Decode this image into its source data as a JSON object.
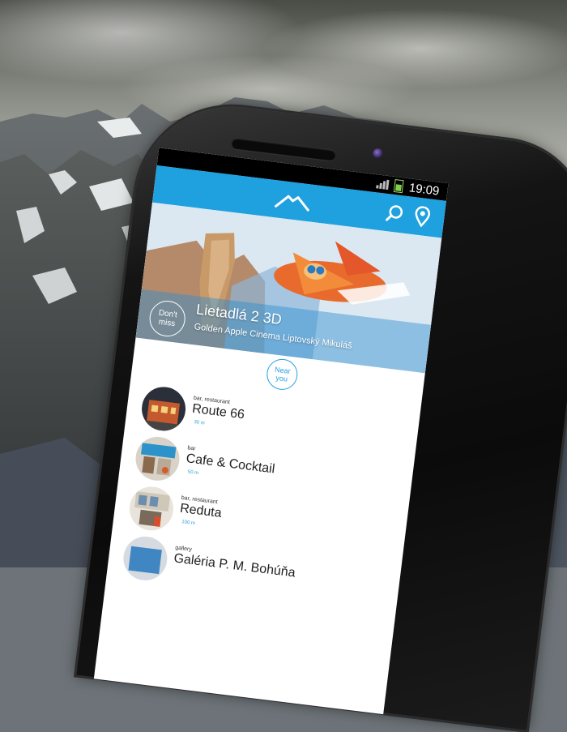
{
  "status": {
    "time": "19:09"
  },
  "appbar": {
    "logo_icon": "mountain-logo-icon",
    "actions": [
      "search-icon",
      "location-pin-icon"
    ],
    "accent": "#1fa0df"
  },
  "featured": {
    "badge": "Don't miss",
    "badge_line1": "Don't",
    "badge_line2": "miss",
    "title": "Lietadlá 2 3D",
    "venue": "Golden Apple Cinema Liptovský Mikuláš"
  },
  "near_button": {
    "line1": "Near",
    "line2": "you"
  },
  "places": [
    {
      "category": "bar, restaurant",
      "name": "Route 66",
      "distance": "30 m"
    },
    {
      "category": "bar",
      "name": "Cafe & Cocktail",
      "distance": "50 m"
    },
    {
      "category": "bar, restaurant",
      "name": "Reduta",
      "distance": "100 m"
    },
    {
      "category": "gallery",
      "name": "Galéria P. M. Bohúňa",
      "distance": ""
    }
  ]
}
